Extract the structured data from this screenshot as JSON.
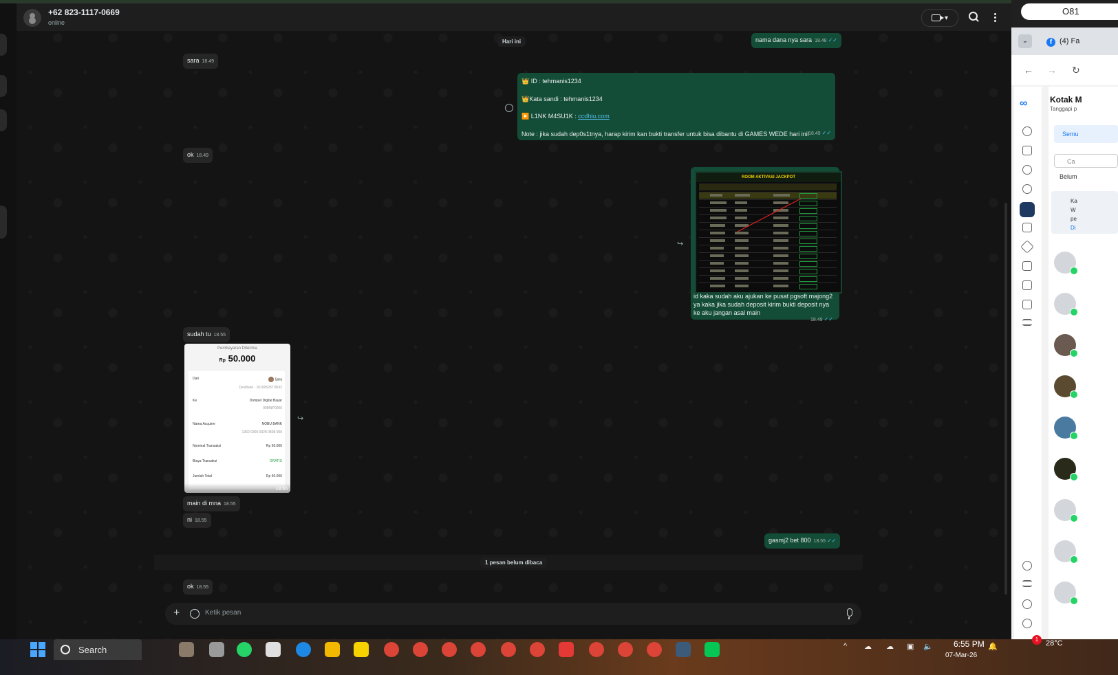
{
  "chat": {
    "contact_name": "+62 823-1117-0669",
    "status": "online",
    "day_label": "Hari ini",
    "unread_label": "1 pesan belum dibaca",
    "composer_placeholder": "Ketik pesan",
    "messages": [
      {
        "id": "m1",
        "dir": "out",
        "text": "nama dana nya sara",
        "time": "18.48"
      },
      {
        "id": "m2",
        "dir": "in",
        "text": "sara",
        "time": "18.49"
      },
      {
        "id": "m3",
        "dir": "out",
        "lines": [
          "👑 ID :  tehmanis1234",
          "👑Kata sandi : tehmanis1234",
          "▶️ L1NK M4SU1K : ",
          "Note : jika sudah dep0s1tnya, harap kirim kan bukti transfer untuk bisa dibantu di GAMES WEDE hari ini!"
        ],
        "link": "ccdhiu.com",
        "time": "18.49"
      },
      {
        "id": "m4",
        "dir": "in",
        "text": "ok",
        "time": "18.49"
      },
      {
        "id": "m5",
        "dir": "out",
        "image_title": "ROOM AKTIVASI JACKPOT",
        "text": "id kaka sudah aku ajukan ke pusat pgsoft majong2 ya kaka jika sudah deposit kirim bukti deposit nya ke aku jangan asal main",
        "time": "18.49"
      },
      {
        "id": "m6",
        "dir": "in",
        "text": "sudah tu",
        "time": "18.55"
      },
      {
        "id": "m7",
        "dir": "in",
        "type": "image",
        "time": "18.55"
      },
      {
        "id": "m8",
        "dir": "in",
        "text": "main di mna",
        "time": "18.55"
      },
      {
        "id": "m9",
        "dir": "in",
        "text": "ni",
        "time": "18.55"
      },
      {
        "id": "m10",
        "dir": "out",
        "text": "gasmj2 bet 800",
        "time": "18.55"
      },
      {
        "id": "m11",
        "dir": "in",
        "text": "ok",
        "time": "18.55"
      }
    ],
    "receipt": {
      "title": "Pembayaran Diterima",
      "currency": "Rp",
      "amount": "50.000",
      "from_label": "Dari",
      "from_name": "Sara",
      "from_sub": "DeaBank · 101005287.8632",
      "to_label": "Ke",
      "to_name": "Dompet Digital Bayar",
      "to_sub": "00MNP0000",
      "acquirer_label": "Nama Acquirer",
      "acquirer": "NOBU BANK",
      "acquirer_sub": "1360 0300 0028 0808 000",
      "nominal_label": "Nominal Transaksi",
      "nominal": "Rp 50.000",
      "fee_label": "Biaya Transaksi",
      "fee": "GRATIS",
      "total_label": "Jumlah Total",
      "total": "Rp 50.000"
    }
  },
  "facebook": {
    "search_text": "O81",
    "tab_title": "(4) Fa",
    "page_title": "Kotak M",
    "page_subtitle": "Tanggapi p",
    "filter_chip": "Semu",
    "search_placeholder": "Ca",
    "unread_filter": "Belum",
    "info_lines": [
      "Ka",
      "W",
      "pe",
      "Di"
    ]
  },
  "taskbar": {
    "search_label": "Search",
    "time": "6:55 PM",
    "date": "07-Mar-26",
    "temperature": "28°C",
    "notification_count": "1",
    "accent": "#4aa7ff"
  },
  "colors": {
    "outgoing_bubble": "#144d37",
    "incoming_bubble": "#262626",
    "read_ticks": "#53bdeb",
    "jackpot_title": "#f2d100"
  }
}
